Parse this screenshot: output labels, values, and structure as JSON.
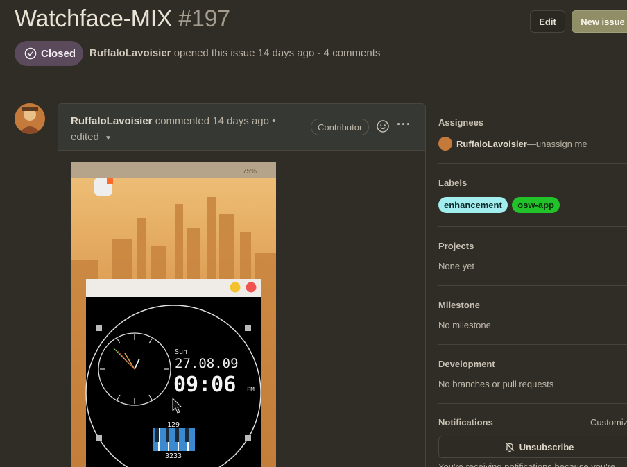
{
  "issue": {
    "title": "Watchface-MIX",
    "number": "#197",
    "state": "Closed",
    "author": "RuffaloLavoisier",
    "meta_text": "opened this issue 14 days ago · 4 comments"
  },
  "actions": {
    "edit_label": "Edit",
    "new_issue_label": "New issue"
  },
  "comment": {
    "author": "RuffaloLavoisier",
    "action": "commented 14 days ago •",
    "edited": "edited",
    "role": "Contributor",
    "more": "···"
  },
  "phone": {
    "battery": "75%",
    "watch": {
      "day": "Sun",
      "date": "27.08.09",
      "time": "09:06",
      "ampm": "PM",
      "steps_top": "129",
      "steps_bottom": "3233"
    }
  },
  "sidebar": {
    "assignees": {
      "title": "Assignees",
      "name": "RuffaloLavoisier",
      "unassign": "—unassign me"
    },
    "labels": {
      "title": "Labels",
      "items": [
        {
          "name": "enhancement",
          "color": "#a2eeef"
        },
        {
          "name": "osw-app",
          "color": "#22c32a"
        }
      ]
    },
    "projects": {
      "title": "Projects",
      "value": "None yet"
    },
    "milestone": {
      "title": "Milestone",
      "value": "No milestone"
    },
    "development": {
      "title": "Development",
      "value": "No branches or pull requests"
    },
    "notifications": {
      "title": "Notifications",
      "customize": "Customize",
      "unsubscribe": "Unsubscribe",
      "reason": "You're receiving notifications because you're"
    }
  }
}
